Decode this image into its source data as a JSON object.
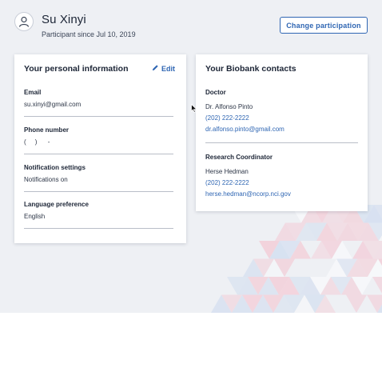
{
  "header": {
    "user_name": "Su Xinyi",
    "participant_since": "Participant since Jul 10, 2019",
    "change_participation_label": "Change participation",
    "avatar_icon": "user-avatar-icon"
  },
  "personal_info": {
    "title": "Your personal information",
    "edit_label": "Edit",
    "edit_icon": "pencil-icon",
    "fields": [
      {
        "label": "Email",
        "value": "su.xinyi@gmail.com"
      },
      {
        "label": "Phone number",
        "value": "(     )      -"
      },
      {
        "label": "Notification settings",
        "value": "Notifications on"
      },
      {
        "label": "Language preference",
        "value": "English"
      }
    ]
  },
  "biobank_contacts": {
    "title": "Your Biobank contacts",
    "doctor": {
      "label": "Doctor",
      "name": "Dr. Alfonso Pinto",
      "phone": "(202) 222-2222",
      "email": "dr.alfonso.pinto@gmail.com"
    },
    "coordinator": {
      "label": "Research Coordinator",
      "name": "Herse Hedman",
      "phone": "(202) 222-2222",
      "email": "herse.hedman@ncorp.nci.gov"
    }
  },
  "colors": {
    "accent": "#2f66b3",
    "background": "#eef0f4",
    "pattern_pink": "#f2d3dc",
    "pattern_blue": "#d6e0f0"
  }
}
